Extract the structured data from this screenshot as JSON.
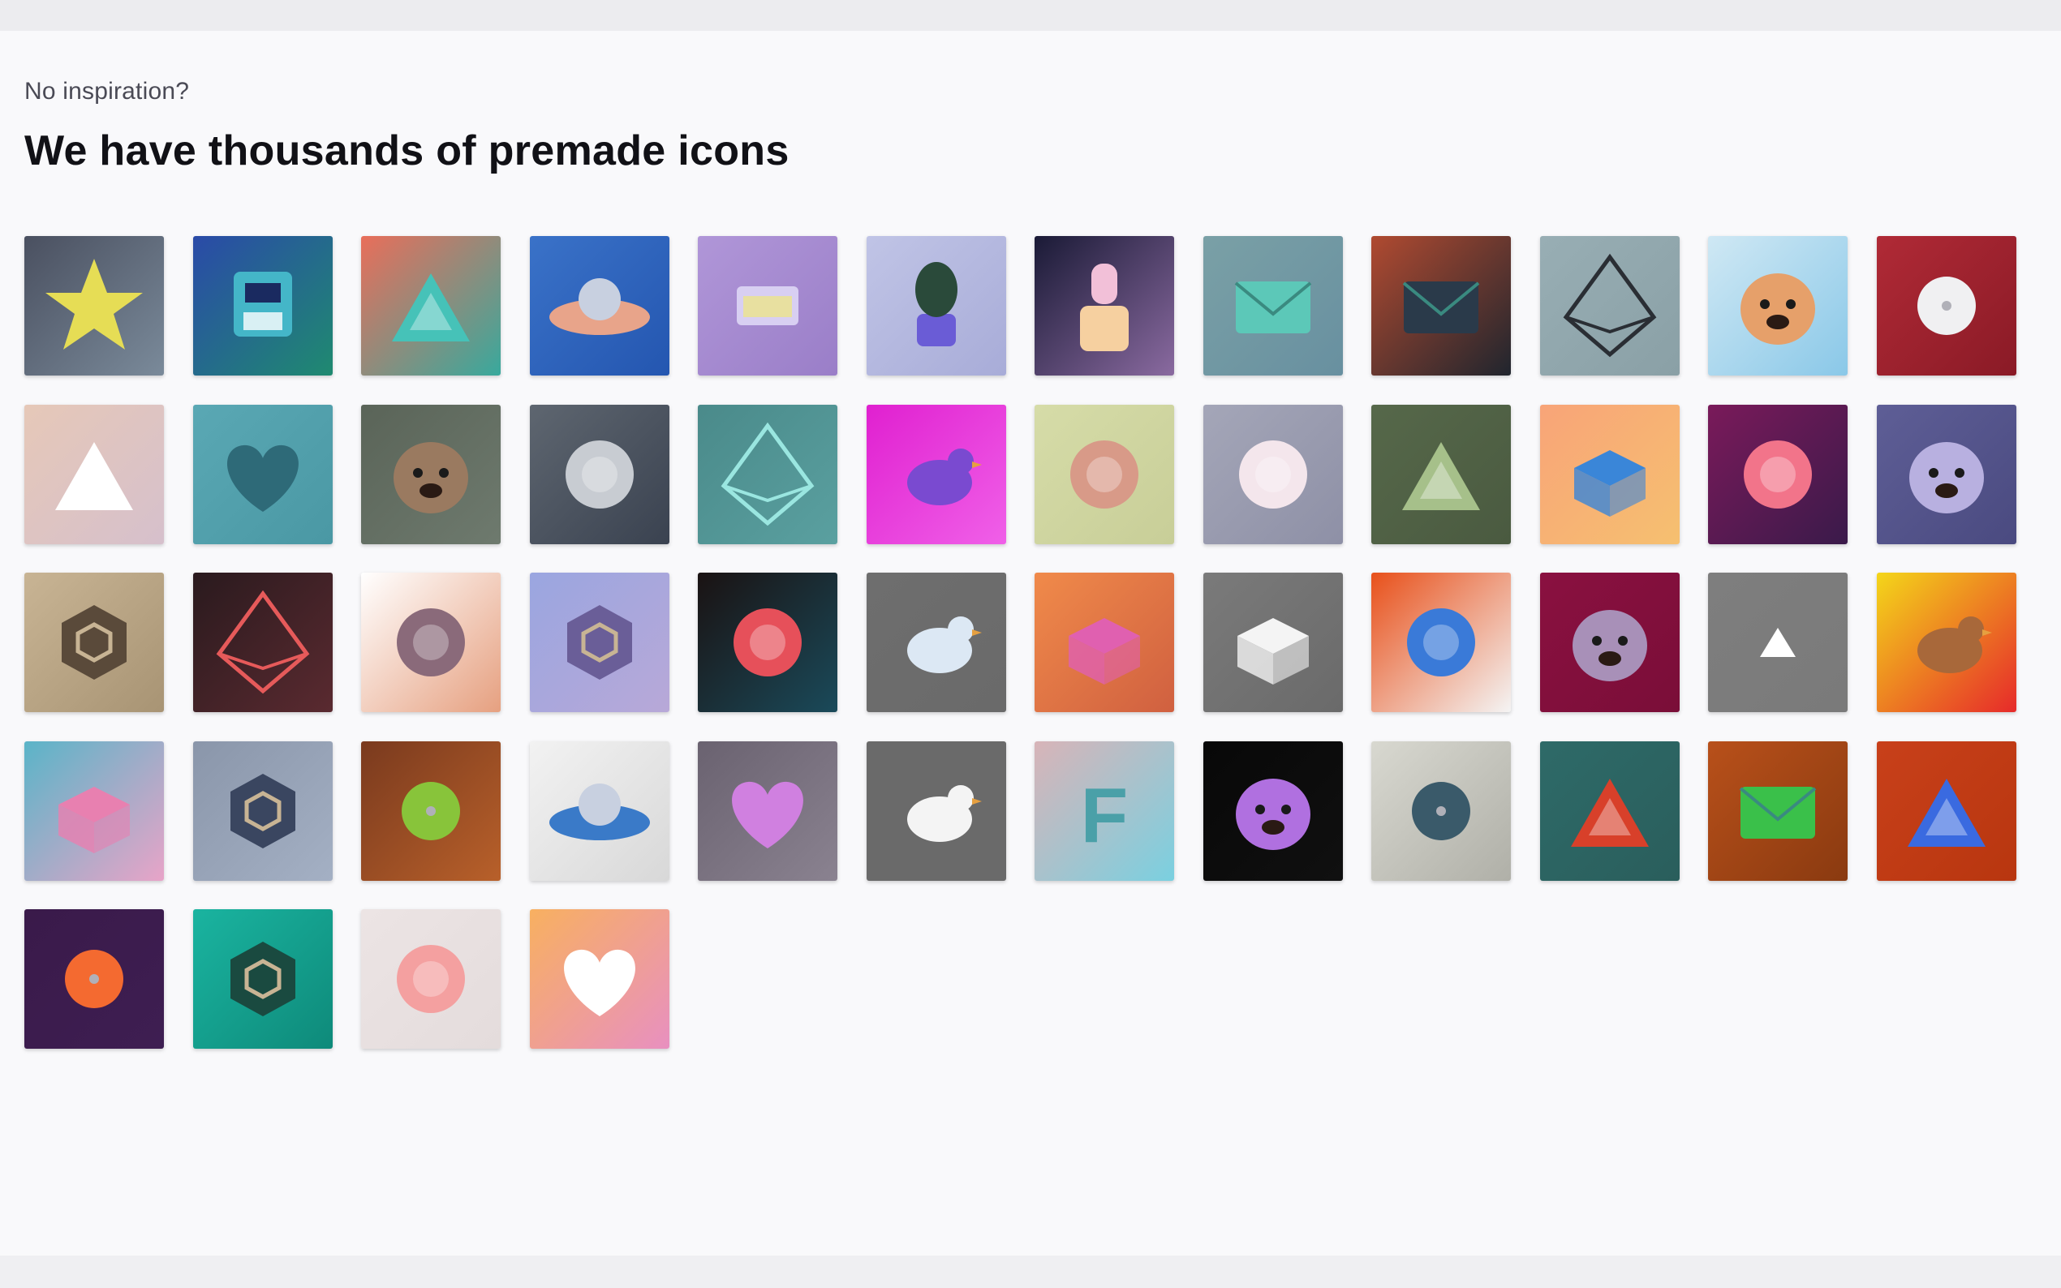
{
  "header": {
    "eyebrow": "No inspiration?",
    "title": "We have thousands of premade icons"
  },
  "icons": [
    {
      "name": "star-icon",
      "bg": "#4a5060",
      "fg": "#e6dd55",
      "bg2": "#7a8a9a"
    },
    {
      "name": "floppy-disk-icon",
      "bg": "#2a4aa8",
      "fg": "#44b6c8",
      "bg2": "#1f8a70"
    },
    {
      "name": "triangle-pattern-icon",
      "bg": "#e96e5a",
      "fg": "#46c2b8",
      "bg2": "#38a99d"
    },
    {
      "name": "planet-ring-icon",
      "bg": "#3a72c8",
      "fg": "#e8a48a",
      "bg2": "#2456b0"
    },
    {
      "name": "calendar-window-icon",
      "bg": "#b096d8",
      "fg": "#d8cff2",
      "bg2": "#9a7ec8"
    },
    {
      "name": "potted-plant-icon",
      "bg": "#c0c4e6",
      "fg": "#6a5cd6",
      "bg2": "#a8acd8"
    },
    {
      "name": "nail-polish-icon",
      "bg": "#1a1a36",
      "fg": "#f2c0d8",
      "bg2": "#8a6aa0"
    },
    {
      "name": "envelope-icon",
      "bg": "#7aa0a6",
      "fg": "#5cc8b8",
      "bg2": "#6890a0"
    },
    {
      "name": "dark-envelope-icon",
      "bg": "#b04a30",
      "fg": "#2a3a4a",
      "bg2": "#20252e"
    },
    {
      "name": "diamond-outline-icon",
      "bg": "#98aeb4",
      "fg": "#2a2e34",
      "bg2": "#8aa0a6"
    },
    {
      "name": "fox-icon",
      "bg": "#cfe8f4",
      "fg": "#e6a06a",
      "bg2": "#8ac8e8"
    },
    {
      "name": "disc-icon",
      "bg": "#b02a36",
      "fg": "#f0f0f2",
      "bg2": "#8a1a26"
    },
    {
      "name": "pyramid-ring-icon",
      "bg": "#e6c8b8",
      "fg": "#ffffff",
      "bg2": "#d6c0cc"
    },
    {
      "name": "heart-outline-icon",
      "bg": "#5aa8b4",
      "fg": "#2e6a78",
      "bg2": "#4a98a4"
    },
    {
      "name": "pug-dog-icon",
      "bg": "#5a6458",
      "fg": "#9a7a60",
      "bg2": "#6e7a6e"
    },
    {
      "name": "curved-shield-icon",
      "bg": "#5e6670",
      "fg": "#c8ccd2",
      "bg2": "#3a4250"
    },
    {
      "name": "geometric-diamond-icon",
      "bg": "#4a8a8a",
      "fg": "#9ae6e0",
      "bg2": "#5aa0a0"
    },
    {
      "name": "penguin-icon",
      "bg": "#e020d0",
      "fg": "#7a4ad0",
      "bg2": "#f060e8"
    },
    {
      "name": "flower-icon",
      "bg": "#d6dca8",
      "fg": "#d89a88",
      "bg2": "#c8ce98"
    },
    {
      "name": "game-controller-icon",
      "bg": "#a4a6b8",
      "fg": "#f4e6ec",
      "bg2": "#8e90a6"
    },
    {
      "name": "green-pyramid-icon",
      "bg": "#56684a",
      "fg": "#a6c08a",
      "bg2": "#4a5a40"
    },
    {
      "name": "fax-machine-icon",
      "bg": "#f8a478",
      "fg": "#3a86d8",
      "bg2": "#f6c070"
    },
    {
      "name": "money-bag-icon",
      "bg": "#7a1a5a",
      "fg": "#f2748a",
      "bg2": "#3a1a4a"
    },
    {
      "name": "owl-icon",
      "bg": "#5e5e96",
      "fg": "#b8b0e0",
      "bg2": "#4a4a80"
    },
    {
      "name": "hexagon-nut-icon",
      "bg": "#c8b494",
      "fg": "#5a4a3a",
      "bg2": "#a89474"
    },
    {
      "name": "kite-icon",
      "bg": "#2a1a1e",
      "fg": "#e65a5a",
      "bg2": "#5a2a30"
    },
    {
      "name": "skateboard-icon",
      "bg": "#ffffff",
      "fg": "#8a6a7a",
      "bg2": "#e6a080"
    },
    {
      "name": "cube-gem-icon",
      "bg": "#9aa6e0",
      "fg": "#6a5e98",
      "bg2": "#b8a8d8"
    },
    {
      "name": "kidney-icon",
      "bg": "#1a1212",
      "fg": "#e6505a",
      "bg2": "#1a4a5a"
    },
    {
      "name": "bird-icon",
      "bg": "#6e6e6e",
      "fg": "#dce8f4",
      "bg2": "#6a6a6a"
    },
    {
      "name": "printer-icon",
      "bg": "#f08a4a",
      "fg": "#e060b0",
      "bg2": "#d06040"
    },
    {
      "name": "plant-box-icon",
      "bg": "#7a7a7a",
      "fg": "#f4f4f4",
      "bg2": "#6a6a6a"
    },
    {
      "name": "paint-brush-icon",
      "bg": "#e8501a",
      "fg": "#3a7ad8",
      "bg2": "#f4f4f4"
    },
    {
      "name": "wolf-icon",
      "bg": "#8a1040",
      "fg": "#a890b8",
      "bg2": "#7a0e38"
    },
    {
      "name": "triangle-up-icon",
      "bg": "#7e7e7e",
      "fg": "#ffffff",
      "bg2": "#7a7a7a"
    },
    {
      "name": "duck-icon",
      "bg": "#f4d61a",
      "fg": "#a8683a",
      "bg2": "#e62a2a"
    },
    {
      "name": "pink-box-icon",
      "bg": "#5ab4c8",
      "fg": "#e880b0",
      "bg2": "#e8a4c8"
    },
    {
      "name": "gem-hexagon-icon",
      "bg": "#8a96aa",
      "fg": "#3a4660",
      "bg2": "#a4b0c4"
    },
    {
      "name": "green-apple-icon",
      "bg": "#7a3a1e",
      "fg": "#88c43a",
      "bg2": "#b8602a"
    },
    {
      "name": "round-table-icon",
      "bg": "#f2f2f2",
      "fg": "#3a7ac8",
      "bg2": "#d8d8d8"
    },
    {
      "name": "heart-button-icon",
      "bg": "#6a6270",
      "fg": "#d080e0",
      "bg2": "#8a8290"
    },
    {
      "name": "rubber-duck-icon",
      "bg": "#6a6a6a",
      "fg": "#f4f4f4",
      "bg2": "#6a6a6a"
    },
    {
      "name": "letter-f-icon",
      "bg": "#d8b4b8",
      "fg": "#4aa0a8",
      "bg2": "#7ad0e0"
    },
    {
      "name": "anime-girl-icon",
      "bg": "#080808",
      "fg": "#b070e0",
      "bg2": "#101010"
    },
    {
      "name": "apple-icon",
      "bg": "#d8d8d0",
      "fg": "#3a5a6a",
      "bg2": "#b0b0a8"
    },
    {
      "name": "mountain-circle-icon",
      "bg": "#2e6a68",
      "fg": "#d8402a",
      "bg2": "#2a5e5c"
    },
    {
      "name": "green-envelope-icon",
      "bg": "#b8501a",
      "fg": "#3ac04a",
      "bg2": "#8a3a10"
    },
    {
      "name": "blue-pyramid-icon",
      "bg": "#c8401a",
      "fg": "#3a6ae0",
      "bg2": "#b8360f"
    },
    {
      "name": "sunset-orb-icon",
      "bg": "#3a1a4a",
      "fg": "#f46a30",
      "bg2": "#3e1e52"
    },
    {
      "name": "ornate-frame-icon",
      "bg": "#1ab4a0",
      "fg": "#1a4a40",
      "bg2": "#0e8a7a"
    },
    {
      "name": "mittens-icon",
      "bg": "#ece4e4",
      "fg": "#f4a0a0",
      "bg2": "#e4dcdc"
    },
    {
      "name": "fried-egg-icon",
      "bg": "#f8b060",
      "fg": "#ffffff",
      "bg2": "#e890c0"
    }
  ]
}
